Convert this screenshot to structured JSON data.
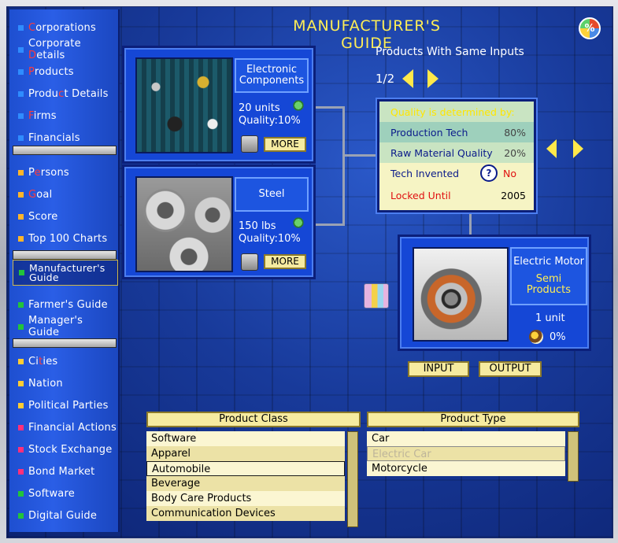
{
  "title": "MANUFACTURER'S GUIDE",
  "percent_icon_label": "%",
  "sidebar": {
    "items": [
      {
        "pre": "",
        "hl": "C",
        "post": "orporations",
        "color": "#2f8cff"
      },
      {
        "pre": "Corporate ",
        "hl": "D",
        "post": "etails",
        "color": "#2f8cff"
      },
      {
        "pre": "",
        "hl": "P",
        "post": "roducts",
        "color": "#2f8cff"
      },
      {
        "pre": "Produ",
        "hl": "c",
        "post": "t Details",
        "color": "#2f8cff"
      },
      {
        "pre": "",
        "hl": "F",
        "post": "irms",
        "color": "#2f8cff"
      },
      {
        "pre": "Financials",
        "hl": "",
        "post": "",
        "color": "#2f8cff"
      },
      {
        "pre": "P",
        "hl": "e",
        "post": "rsons",
        "color": "#ffb52a"
      },
      {
        "pre": "",
        "hl": "G",
        "post": "oal",
        "color": "#ffb52a"
      },
      {
        "pre": "Score",
        "hl": "",
        "post": "",
        "color": "#ffb52a"
      },
      {
        "pre": "Top 100 Charts",
        "hl": "",
        "post": "",
        "color": "#ffb52a"
      },
      {
        "pre": "Manufacturer's Guide",
        "hl": "",
        "post": "",
        "color": "#22c43a"
      },
      {
        "pre": "Farmer's Guide",
        "hl": "",
        "post": "",
        "color": "#22c43a"
      },
      {
        "pre": "Manager's Guide",
        "hl": "",
        "post": "",
        "color": "#22c43a"
      },
      {
        "pre": "Ci",
        "hl": "t",
        "post": "ies",
        "color": "#ffcc33"
      },
      {
        "pre": "Nation",
        "hl": "",
        "post": "",
        "color": "#ffcc33"
      },
      {
        "pre": "Political Parties",
        "hl": "",
        "post": "",
        "color": "#ffcc33"
      },
      {
        "pre": "Financial Actions",
        "hl": "",
        "post": "",
        "color": "#ff2f7a"
      },
      {
        "pre": "Stock Exchange",
        "hl": "",
        "post": "",
        "color": "#ff2f7a"
      },
      {
        "pre": "Bond Market",
        "hl": "",
        "post": "",
        "color": "#ff2f7a"
      },
      {
        "pre": "Software",
        "hl": "",
        "post": "",
        "color": "#22c43a"
      },
      {
        "pre": "Digital Guide",
        "hl": "",
        "post": "",
        "color": "#22c43a"
      }
    ]
  },
  "inputs": [
    {
      "name": "Electronic Components",
      "units": "20 units",
      "quality": "Quality:10%",
      "more": "MORE"
    },
    {
      "name": "Steel",
      "units": "150 lbs",
      "quality": "Quality:10%",
      "more": "MORE"
    }
  ],
  "same_inputs": {
    "label": "Products With Same Inputs",
    "page": "1/2"
  },
  "quality_table": {
    "header": "Quality is determined by:",
    "rows": [
      {
        "label": "Production Tech",
        "value": "80%"
      },
      {
        "label": "Raw Material Quality",
        "value": "20%"
      },
      {
        "label": "Tech Invented",
        "value": "No"
      },
      {
        "label": "Locked Until",
        "value": "2005"
      }
    ]
  },
  "output": {
    "name": "Electric Motor",
    "category": "Semi Products",
    "units": "1 unit",
    "percent": "0%"
  },
  "buttons": {
    "input": "INPUT",
    "output": "OUTPUT"
  },
  "product_class": {
    "header": "Product Class",
    "items": [
      "Software",
      "Apparel",
      "Automobile",
      "Beverage",
      "Body Care Products",
      "Communication Devices"
    ],
    "selected": 2
  },
  "product_type": {
    "header": "Product Type",
    "items": [
      "Car",
      "Electric Car",
      "Motorcycle"
    ],
    "disabled": 1
  }
}
